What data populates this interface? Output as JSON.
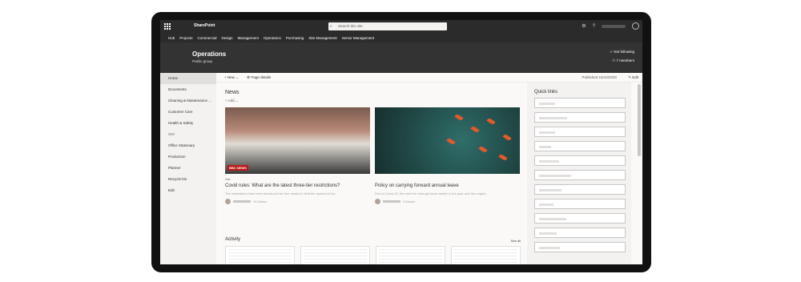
{
  "suitebar": {
    "app_name": "SharePoint",
    "search_placeholder": "Search this site"
  },
  "hubnav": {
    "items": [
      "Hub",
      "Projects",
      "Commercial",
      "Design",
      "Management",
      "Operations",
      "Purchasing",
      "Site Management",
      "Senior Management"
    ]
  },
  "site": {
    "title": "Operations",
    "subtitle": "Public group",
    "follow": "Not following",
    "members": "7 members"
  },
  "leftnav": {
    "items": [
      "Home",
      "Documents",
      "Cleaning & Maintenance ...",
      "Customer Care",
      "Health & Safety",
      "",
      "Office Stationary",
      "Production",
      "Planner",
      "Recycle bin",
      "Edit"
    ]
  },
  "commandbar": {
    "new": "New",
    "details": "Page details",
    "published": "Published 15/10/2020",
    "edit": "Edit"
  },
  "news": {
    "title": "News",
    "add": "Add",
    "cards": [
      {
        "hub": "Hub",
        "headline": "Covid rules: What are the latest three-tier restrictions?",
        "desc": "The restrictions have been introduced for four weeks to limit the spread of the...",
        "date": "15 October",
        "logo": "BBC NEWS"
      },
      {
        "hub": "",
        "headline": "Policy on carrying forward annual leave",
        "desc": "Due to Covid-19, the need for furlough leave earlier in the year and the ongoin...",
        "date": "5 October"
      }
    ]
  },
  "activity": {
    "title": "Activity",
    "see_all": "See all"
  },
  "quick_links": {
    "title": "Quick links",
    "count": 11
  },
  "colors": {
    "suitebar": "#2b2b2b",
    "site_header": "#333333",
    "excel_green": "#217346"
  }
}
